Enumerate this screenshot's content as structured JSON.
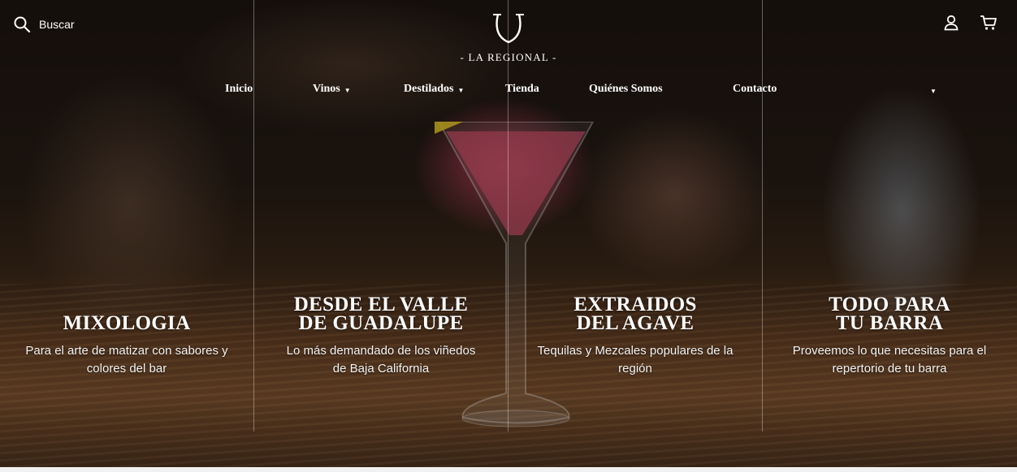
{
  "header": {
    "search_label": "Buscar",
    "logo_text": "- LA REGIONAL -"
  },
  "nav": {
    "items": [
      {
        "label": "Inicio",
        "dropdown": false
      },
      {
        "label": "Vinos",
        "dropdown": true
      },
      {
        "label": "Destilados",
        "dropdown": true
      },
      {
        "label": "Tienda",
        "dropdown": false
      },
      {
        "label": "Quiénes Somos",
        "dropdown": false
      },
      {
        "label": "Contacto",
        "dropdown": false
      }
    ],
    "caret": "▼"
  },
  "columns": [
    {
      "title": "MIXOLOGIA",
      "description": "Para el arte de matizar con sabores y colores del bar"
    },
    {
      "title": "DESDE EL VALLE\nDE GUADALUPE",
      "description": "Lo más demandado de los viñedos de Baja California"
    },
    {
      "title": "EXTRAIDOS\nDEL AGAVE",
      "description": "Tequilas y Mezcales populares de la región"
    },
    {
      "title": "TODO PARA\nTU BARRA",
      "description": "Proveemos lo que necesitas para el repertorio de tu barra"
    }
  ],
  "icons": {
    "search": "search-icon",
    "account": "user-icon",
    "cart": "cart-icon"
  },
  "colors": {
    "text": "#ffffff",
    "cocktail": "#c8465f"
  }
}
